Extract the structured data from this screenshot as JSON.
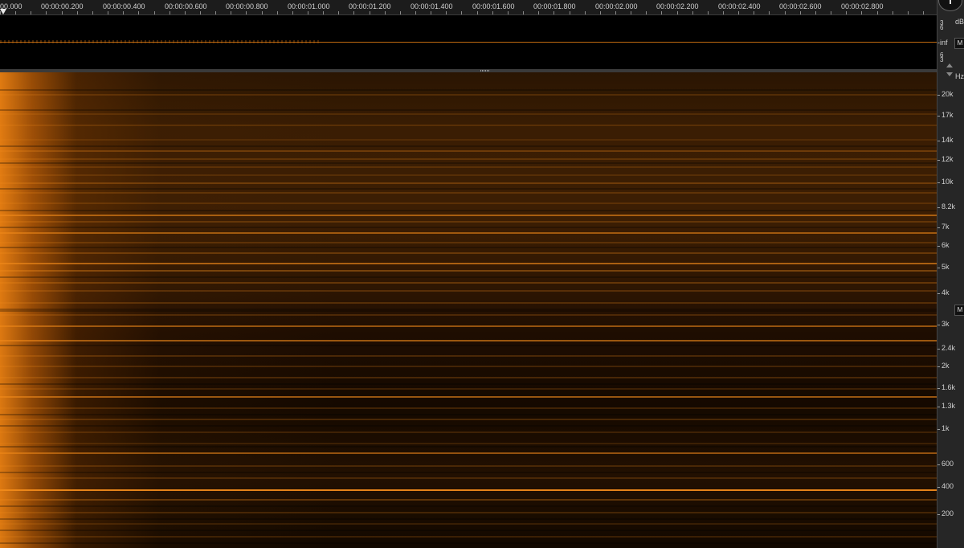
{
  "timeline": {
    "labels": [
      "00.000",
      "00:00:00.200",
      "00:00:00.400",
      "00:00:00.600",
      "00:00:00.800",
      "00:00:01.000",
      "00:00:01.200",
      "00:00:01.400",
      "00:00:01.600",
      "00:00:01.800",
      "00:00:02.000",
      "00:00:02.200",
      "00:00:02.400",
      "00:00:02.600",
      "00:00:02.800"
    ]
  },
  "waveform_scale": {
    "unit": "dB",
    "labels": [
      "3",
      "6",
      "-inf",
      "6",
      "3"
    ],
    "mute_label": "M"
  },
  "spectrogram_scale": {
    "unit": "Hz",
    "labels": [
      "20k",
      "17k",
      "14k",
      "12k",
      "10k",
      "8.2k",
      "7k",
      "6k",
      "5k",
      "4k",
      "3k",
      "2.4k",
      "2k",
      "1.6k",
      "1.3k",
      "1k",
      "600",
      "400",
      "200"
    ],
    "mute_label": "M"
  },
  "colors": {
    "accent": "#f08a1a",
    "background": "#000000",
    "panel": "#262626"
  }
}
